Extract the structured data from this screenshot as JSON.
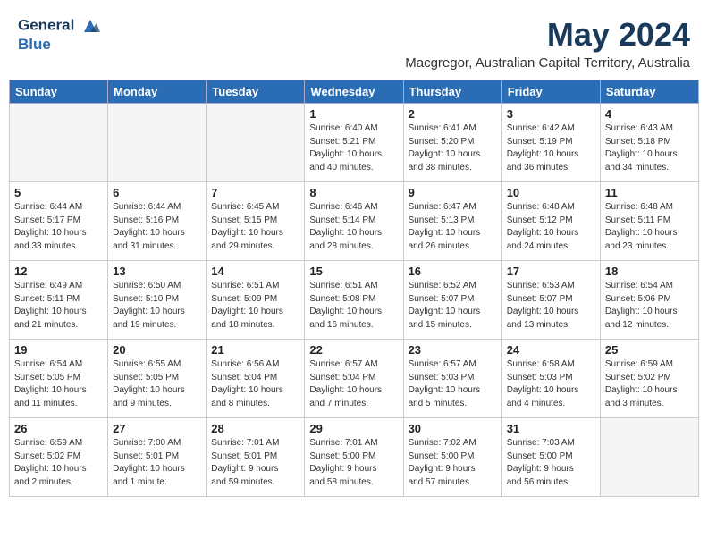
{
  "header": {
    "logo_line1": "General",
    "logo_line2": "Blue",
    "month_year": "May 2024",
    "location": "Macgregor, Australian Capital Territory, Australia"
  },
  "weekdays": [
    "Sunday",
    "Monday",
    "Tuesday",
    "Wednesday",
    "Thursday",
    "Friday",
    "Saturday"
  ],
  "weeks": [
    [
      {
        "day": "",
        "info": ""
      },
      {
        "day": "",
        "info": ""
      },
      {
        "day": "",
        "info": ""
      },
      {
        "day": "1",
        "info": "Sunrise: 6:40 AM\nSunset: 5:21 PM\nDaylight: 10 hours\nand 40 minutes."
      },
      {
        "day": "2",
        "info": "Sunrise: 6:41 AM\nSunset: 5:20 PM\nDaylight: 10 hours\nand 38 minutes."
      },
      {
        "day": "3",
        "info": "Sunrise: 6:42 AM\nSunset: 5:19 PM\nDaylight: 10 hours\nand 36 minutes."
      },
      {
        "day": "4",
        "info": "Sunrise: 6:43 AM\nSunset: 5:18 PM\nDaylight: 10 hours\nand 34 minutes."
      }
    ],
    [
      {
        "day": "5",
        "info": "Sunrise: 6:44 AM\nSunset: 5:17 PM\nDaylight: 10 hours\nand 33 minutes."
      },
      {
        "day": "6",
        "info": "Sunrise: 6:44 AM\nSunset: 5:16 PM\nDaylight: 10 hours\nand 31 minutes."
      },
      {
        "day": "7",
        "info": "Sunrise: 6:45 AM\nSunset: 5:15 PM\nDaylight: 10 hours\nand 29 minutes."
      },
      {
        "day": "8",
        "info": "Sunrise: 6:46 AM\nSunset: 5:14 PM\nDaylight: 10 hours\nand 28 minutes."
      },
      {
        "day": "9",
        "info": "Sunrise: 6:47 AM\nSunset: 5:13 PM\nDaylight: 10 hours\nand 26 minutes."
      },
      {
        "day": "10",
        "info": "Sunrise: 6:48 AM\nSunset: 5:12 PM\nDaylight: 10 hours\nand 24 minutes."
      },
      {
        "day": "11",
        "info": "Sunrise: 6:48 AM\nSunset: 5:11 PM\nDaylight: 10 hours\nand 23 minutes."
      }
    ],
    [
      {
        "day": "12",
        "info": "Sunrise: 6:49 AM\nSunset: 5:11 PM\nDaylight: 10 hours\nand 21 minutes."
      },
      {
        "day": "13",
        "info": "Sunrise: 6:50 AM\nSunset: 5:10 PM\nDaylight: 10 hours\nand 19 minutes."
      },
      {
        "day": "14",
        "info": "Sunrise: 6:51 AM\nSunset: 5:09 PM\nDaylight: 10 hours\nand 18 minutes."
      },
      {
        "day": "15",
        "info": "Sunrise: 6:51 AM\nSunset: 5:08 PM\nDaylight: 10 hours\nand 16 minutes."
      },
      {
        "day": "16",
        "info": "Sunrise: 6:52 AM\nSunset: 5:07 PM\nDaylight: 10 hours\nand 15 minutes."
      },
      {
        "day": "17",
        "info": "Sunrise: 6:53 AM\nSunset: 5:07 PM\nDaylight: 10 hours\nand 13 minutes."
      },
      {
        "day": "18",
        "info": "Sunrise: 6:54 AM\nSunset: 5:06 PM\nDaylight: 10 hours\nand 12 minutes."
      }
    ],
    [
      {
        "day": "19",
        "info": "Sunrise: 6:54 AM\nSunset: 5:05 PM\nDaylight: 10 hours\nand 11 minutes."
      },
      {
        "day": "20",
        "info": "Sunrise: 6:55 AM\nSunset: 5:05 PM\nDaylight: 10 hours\nand 9 minutes."
      },
      {
        "day": "21",
        "info": "Sunrise: 6:56 AM\nSunset: 5:04 PM\nDaylight: 10 hours\nand 8 minutes."
      },
      {
        "day": "22",
        "info": "Sunrise: 6:57 AM\nSunset: 5:04 PM\nDaylight: 10 hours\nand 7 minutes."
      },
      {
        "day": "23",
        "info": "Sunrise: 6:57 AM\nSunset: 5:03 PM\nDaylight: 10 hours\nand 5 minutes."
      },
      {
        "day": "24",
        "info": "Sunrise: 6:58 AM\nSunset: 5:03 PM\nDaylight: 10 hours\nand 4 minutes."
      },
      {
        "day": "25",
        "info": "Sunrise: 6:59 AM\nSunset: 5:02 PM\nDaylight: 10 hours\nand 3 minutes."
      }
    ],
    [
      {
        "day": "26",
        "info": "Sunrise: 6:59 AM\nSunset: 5:02 PM\nDaylight: 10 hours\nand 2 minutes."
      },
      {
        "day": "27",
        "info": "Sunrise: 7:00 AM\nSunset: 5:01 PM\nDaylight: 10 hours\nand 1 minute."
      },
      {
        "day": "28",
        "info": "Sunrise: 7:01 AM\nSunset: 5:01 PM\nDaylight: 9 hours\nand 59 minutes."
      },
      {
        "day": "29",
        "info": "Sunrise: 7:01 AM\nSunset: 5:00 PM\nDaylight: 9 hours\nand 58 minutes."
      },
      {
        "day": "30",
        "info": "Sunrise: 7:02 AM\nSunset: 5:00 PM\nDaylight: 9 hours\nand 57 minutes."
      },
      {
        "day": "31",
        "info": "Sunrise: 7:03 AM\nSunset: 5:00 PM\nDaylight: 9 hours\nand 56 minutes."
      },
      {
        "day": "",
        "info": ""
      }
    ]
  ]
}
